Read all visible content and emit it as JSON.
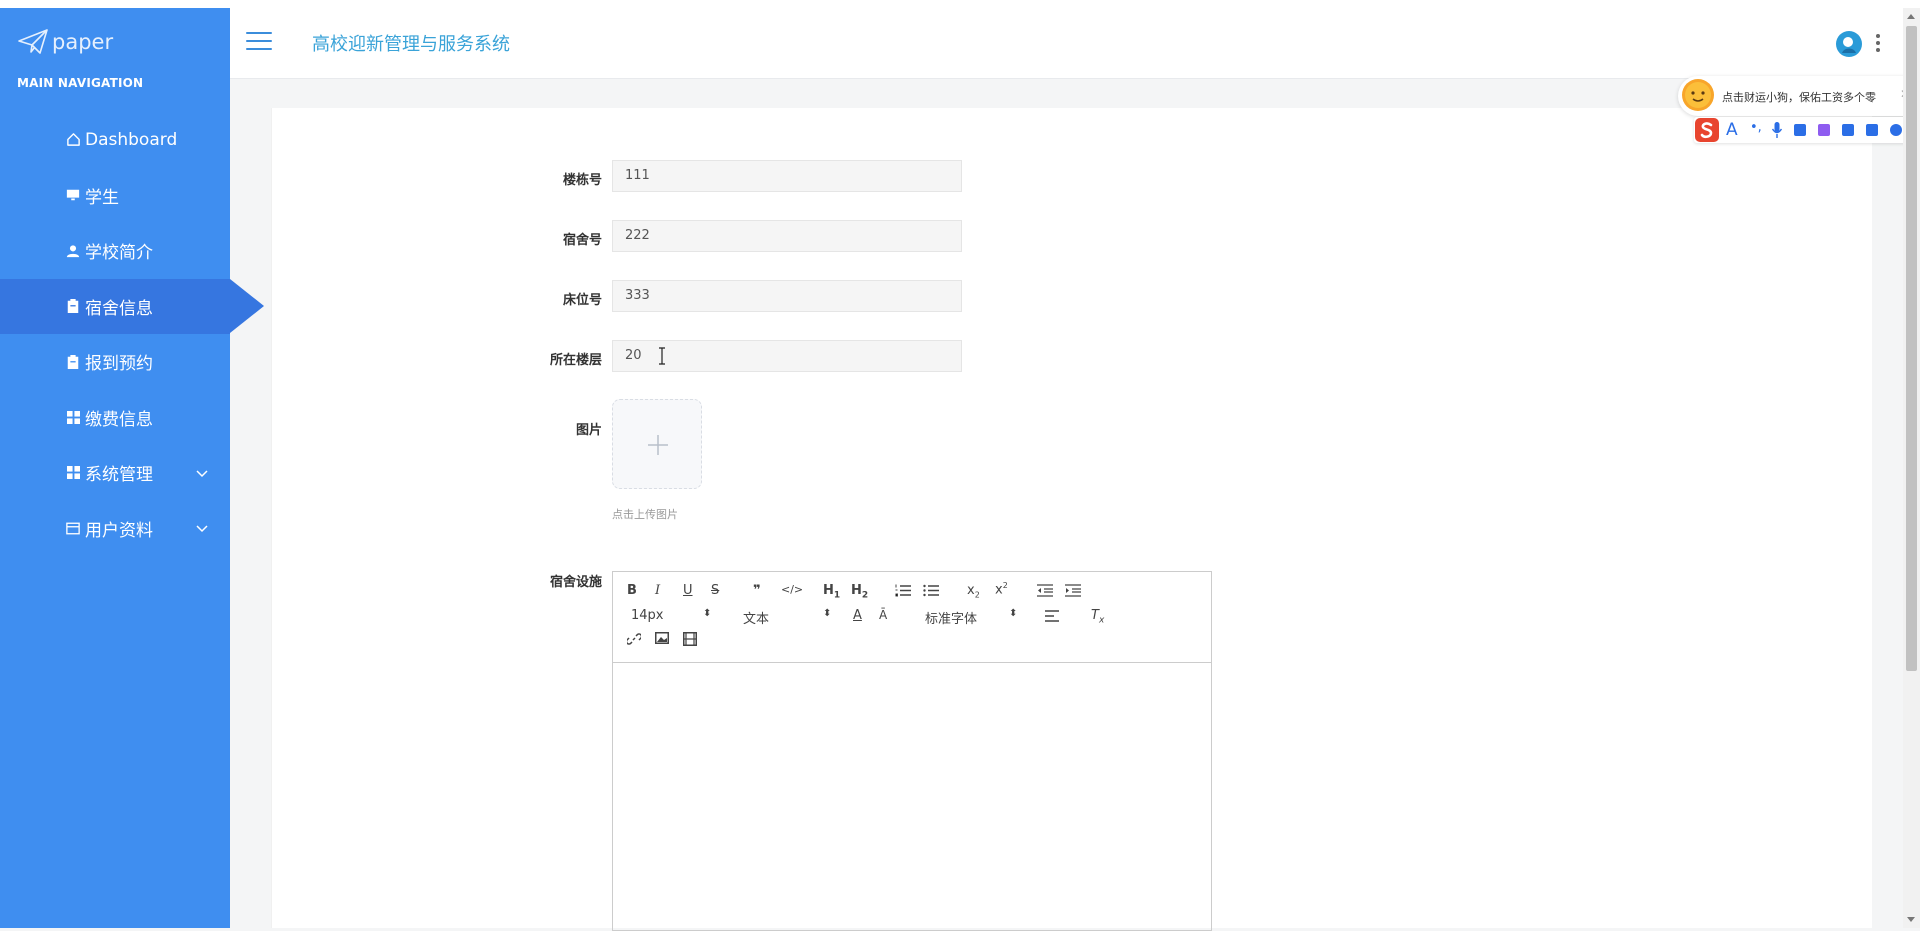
{
  "brand": {
    "logo_text": "paper"
  },
  "sidebar": {
    "heading": "MAIN NAVIGATION",
    "items": [
      {
        "label": "Dashboard",
        "icon": "home-icon"
      },
      {
        "label": "学生",
        "icon": "monitor-icon"
      },
      {
        "label": "学校简介",
        "icon": "user-icon"
      },
      {
        "label": "宿舍信息",
        "icon": "clipboard-icon",
        "active": true
      },
      {
        "label": "报到预约",
        "icon": "clipboard-icon"
      },
      {
        "label": "缴费信息",
        "icon": "grid-icon"
      },
      {
        "label": "系统管理",
        "icon": "grid-icon",
        "expandable": true
      },
      {
        "label": "用户资料",
        "icon": "card-icon",
        "expandable": true
      }
    ]
  },
  "header": {
    "title": "高校迎新管理与服务系统"
  },
  "form": {
    "fields": [
      {
        "label": "楼栋号",
        "value": "111"
      },
      {
        "label": "宿舍号",
        "value": "222"
      },
      {
        "label": "床位号",
        "value": "333"
      },
      {
        "label": "所在楼层",
        "value": "20"
      }
    ],
    "image_label": "图片",
    "upload_hint": "点击上传图片",
    "facilities_label": "宿舍设施"
  },
  "editor": {
    "font_size": "14px",
    "text_style": "文本",
    "font_family": "标准字体"
  },
  "ime": {
    "message": "点击财运小狗，保佑工资多个零"
  },
  "colors": {
    "sidebar_bg": "#3f8ef0",
    "sidebar_active": "#3676e0",
    "title_color": "#3aa3d8"
  }
}
